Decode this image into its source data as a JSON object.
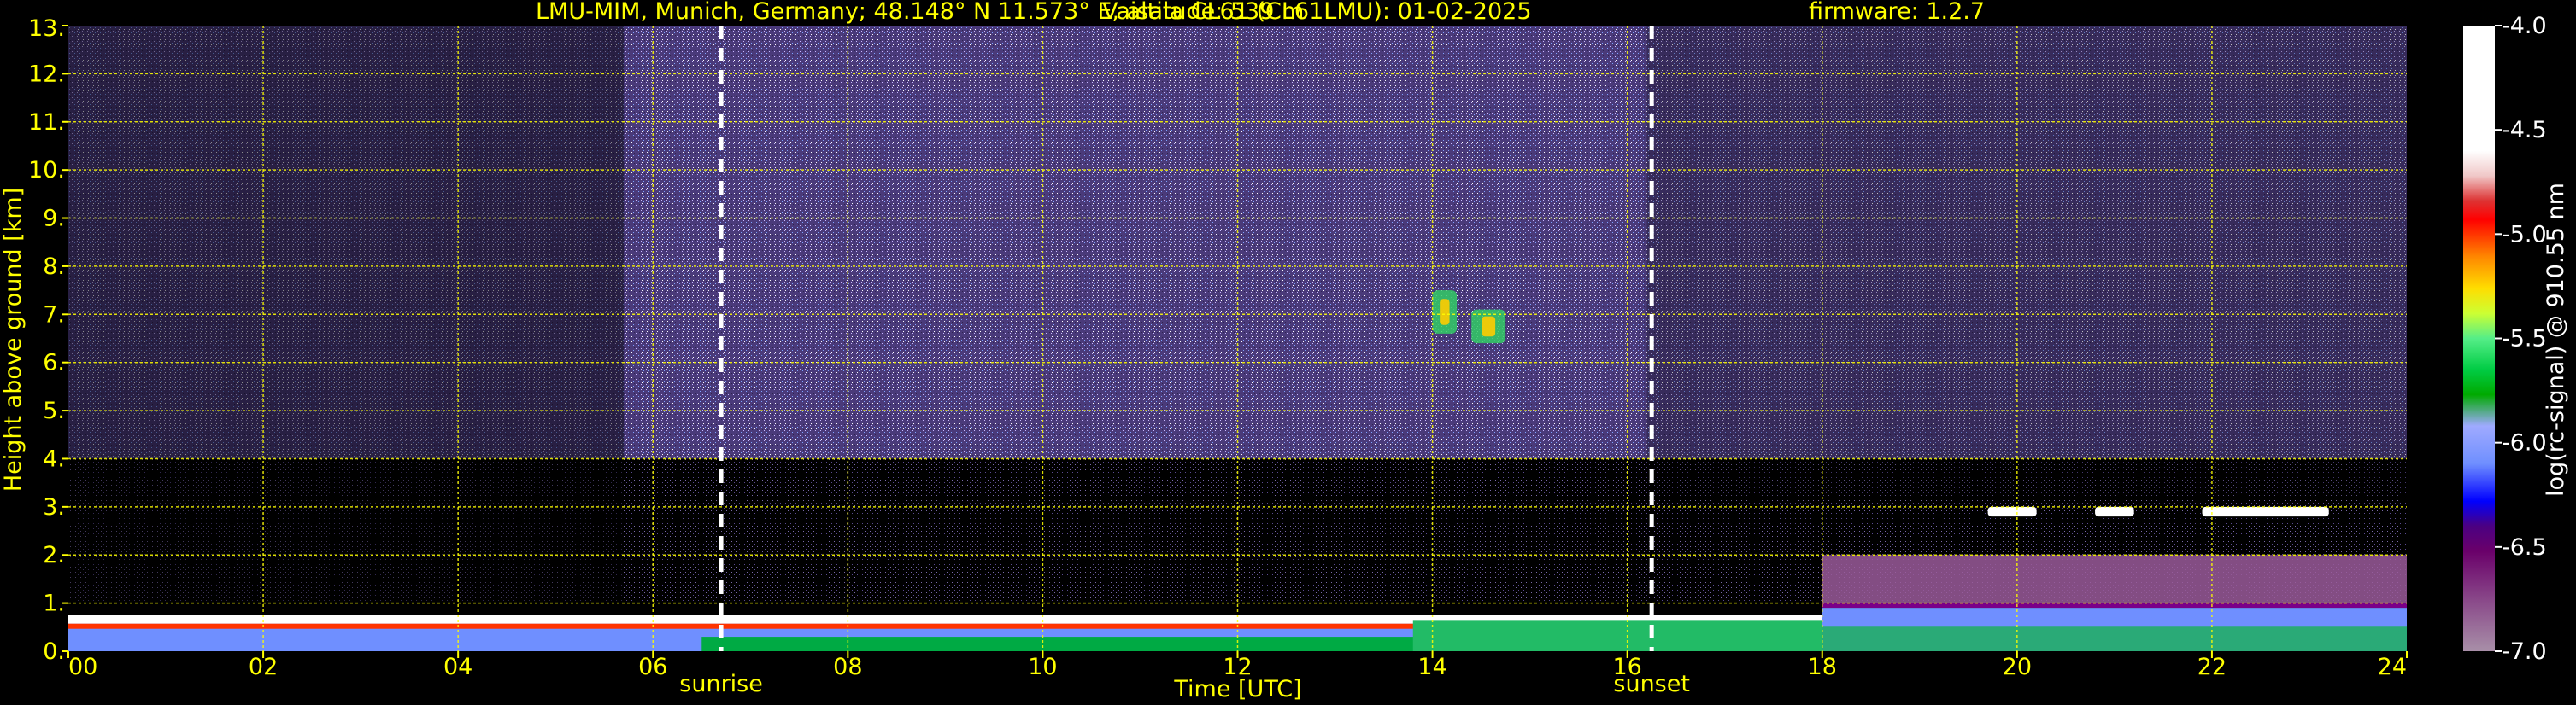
{
  "title": {
    "station": "LMU-MIM, Munich, Germany; 48.148° N 11.573° E, altitude: 539 m",
    "instrument": "Vaisala CL61 (CL61LMU): 01-02-2025",
    "firmware": "firmware: 1.2.7"
  },
  "chart_data": {
    "type": "heatmap",
    "xlabel": "Time [UTC]",
    "ylabel": "Height above ground [km]",
    "xlim": [
      0,
      24
    ],
    "ylim": [
      0,
      13
    ],
    "x_ticks": [
      "00",
      "02",
      "04",
      "06",
      "08",
      "10",
      "12",
      "14",
      "16",
      "18",
      "20",
      "22",
      "24"
    ],
    "x_tick_values": [
      0,
      2,
      4,
      6,
      8,
      10,
      12,
      14,
      16,
      18,
      20,
      22,
      24
    ],
    "y_ticks": [
      "0.",
      "1.",
      "2.",
      "3.",
      "4.",
      "5.",
      "6.",
      "7.",
      "8.",
      "9.",
      "10.",
      "11.",
      "12.",
      "13."
    ],
    "y_tick_values": [
      0,
      1,
      2,
      3,
      4,
      5,
      6,
      7,
      8,
      9,
      10,
      11,
      12,
      13
    ],
    "grid": true,
    "events": [
      {
        "label": "sunrise",
        "time": 6.7
      },
      {
        "label": "sunset",
        "time": 16.25
      }
    ],
    "colorbar": {
      "label": "log(rc-signal) @ 910.55 nm",
      "range": [
        -7.0,
        -4.0
      ],
      "ticks": [
        "-4.0",
        "-4.5",
        "-5.0",
        "-5.5",
        "-6.0",
        "-6.5",
        "-7.0"
      ],
      "tick_values": [
        -4.0,
        -4.5,
        -5.0,
        -5.5,
        -6.0,
        -6.5,
        -7.0
      ],
      "position": "right"
    },
    "features": [
      {
        "name": "boundary-layer",
        "time_start": 0,
        "time_end": 18,
        "top_km": 0.75
      },
      {
        "name": "cirrus-cloud-1",
        "time_start": 14.0,
        "time_end": 14.25,
        "height_start_km": 6.6,
        "height_end_km": 7.5
      },
      {
        "name": "cirrus-cloud-2",
        "time_start": 14.4,
        "time_end": 14.75,
        "height_start_km": 6.4,
        "height_end_km": 7.1
      },
      {
        "name": "elevated-layer",
        "time_start": 18.0,
        "time_end": 24.0,
        "height_start_km": 0.0,
        "height_end_km": 3.0
      },
      {
        "name": "cloud-base-2.9km",
        "time_start": 19.7,
        "time_end": 23.2,
        "height_start_km": 2.8,
        "height_end_km": 3.0
      }
    ]
  }
}
